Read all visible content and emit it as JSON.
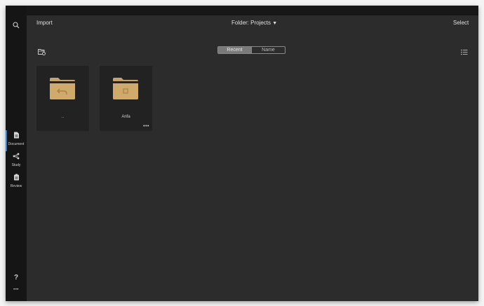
{
  "toolbar": {
    "import_label": "Import",
    "folder_label": "Folder: Projects",
    "folder_caret": "▼",
    "select_label": "Select"
  },
  "sort": {
    "options": [
      "Recent",
      "Name"
    ],
    "selected": "Recent"
  },
  "sidebar": {
    "items": [
      {
        "label": "Document",
        "icon": "document-icon",
        "active": true
      },
      {
        "label": "Study",
        "icon": "study-icon",
        "active": false
      },
      {
        "label": "Review",
        "icon": "review-icon",
        "active": false
      }
    ],
    "help_glyph": "?",
    "more_glyph": "•••"
  },
  "folders": [
    {
      "label": "..",
      "icon": "parent-folder-icon"
    },
    {
      "label": "Anfa",
      "icon": "folder-icon",
      "more": "•••"
    }
  ],
  "colors": {
    "folder": "#c8a265",
    "accent": "#2f82d8",
    "background": "#2c2c2c",
    "sidebar": "#151515"
  }
}
